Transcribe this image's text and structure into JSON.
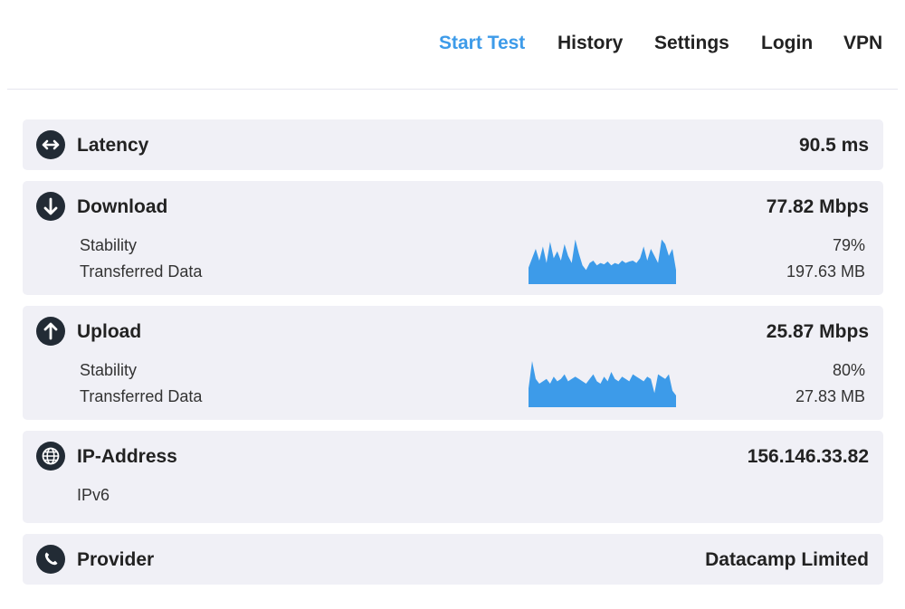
{
  "nav": {
    "items": [
      {
        "label": "Start Test"
      },
      {
        "label": "History"
      },
      {
        "label": "Settings"
      },
      {
        "label": "Login"
      },
      {
        "label": "VPN"
      }
    ],
    "active_index": 0,
    "active_color": "#3d9be9"
  },
  "latency": {
    "icon": "left-right-arrow-icon",
    "title": "Latency",
    "value": "90.5 ms"
  },
  "download": {
    "icon": "arrow-down-icon",
    "title": "Download",
    "value": "77.82 Mbps",
    "stability_label": "Stability",
    "stability_value": "79%",
    "transferred_label": "Transferred Data",
    "transferred_value": "197.63 MB",
    "sparkline_color": "#3d9be9",
    "sparkline": [
      0.35,
      0.55,
      0.75,
      0.5,
      0.8,
      0.45,
      0.9,
      0.55,
      0.7,
      0.5,
      0.85,
      0.6,
      0.45,
      0.95,
      0.65,
      0.4,
      0.3,
      0.45,
      0.5,
      0.4,
      0.45,
      0.42,
      0.48,
      0.4,
      0.45,
      0.42,
      0.5,
      0.45,
      0.48,
      0.5,
      0.45,
      0.55,
      0.8,
      0.5,
      0.75,
      0.6,
      0.45,
      0.95,
      0.85,
      0.6,
      0.75,
      0.3
    ]
  },
  "upload": {
    "icon": "arrow-up-icon",
    "title": "Upload",
    "value": "25.87 Mbps",
    "stability_label": "Stability",
    "stability_value": "80%",
    "transferred_label": "Transferred Data",
    "transferred_value": "27.83 MB",
    "sparkline_color": "#3d9be9",
    "sparkline": [
      0.4,
      0.98,
      0.6,
      0.5,
      0.55,
      0.6,
      0.5,
      0.65,
      0.55,
      0.6,
      0.7,
      0.55,
      0.6,
      0.65,
      0.6,
      0.55,
      0.5,
      0.6,
      0.7,
      0.55,
      0.5,
      0.65,
      0.55,
      0.75,
      0.6,
      0.55,
      0.65,
      0.6,
      0.55,
      0.7,
      0.65,
      0.6,
      0.55,
      0.65,
      0.6,
      0.3,
      0.7,
      0.65,
      0.6,
      0.7,
      0.35,
      0.25
    ]
  },
  "ip": {
    "icon": "globe-icon",
    "title": "IP-Address",
    "value": "156.146.33.82",
    "version": "IPv6"
  },
  "provider": {
    "icon": "phone-icon",
    "title": "Provider",
    "value": "Datacamp Limited"
  }
}
